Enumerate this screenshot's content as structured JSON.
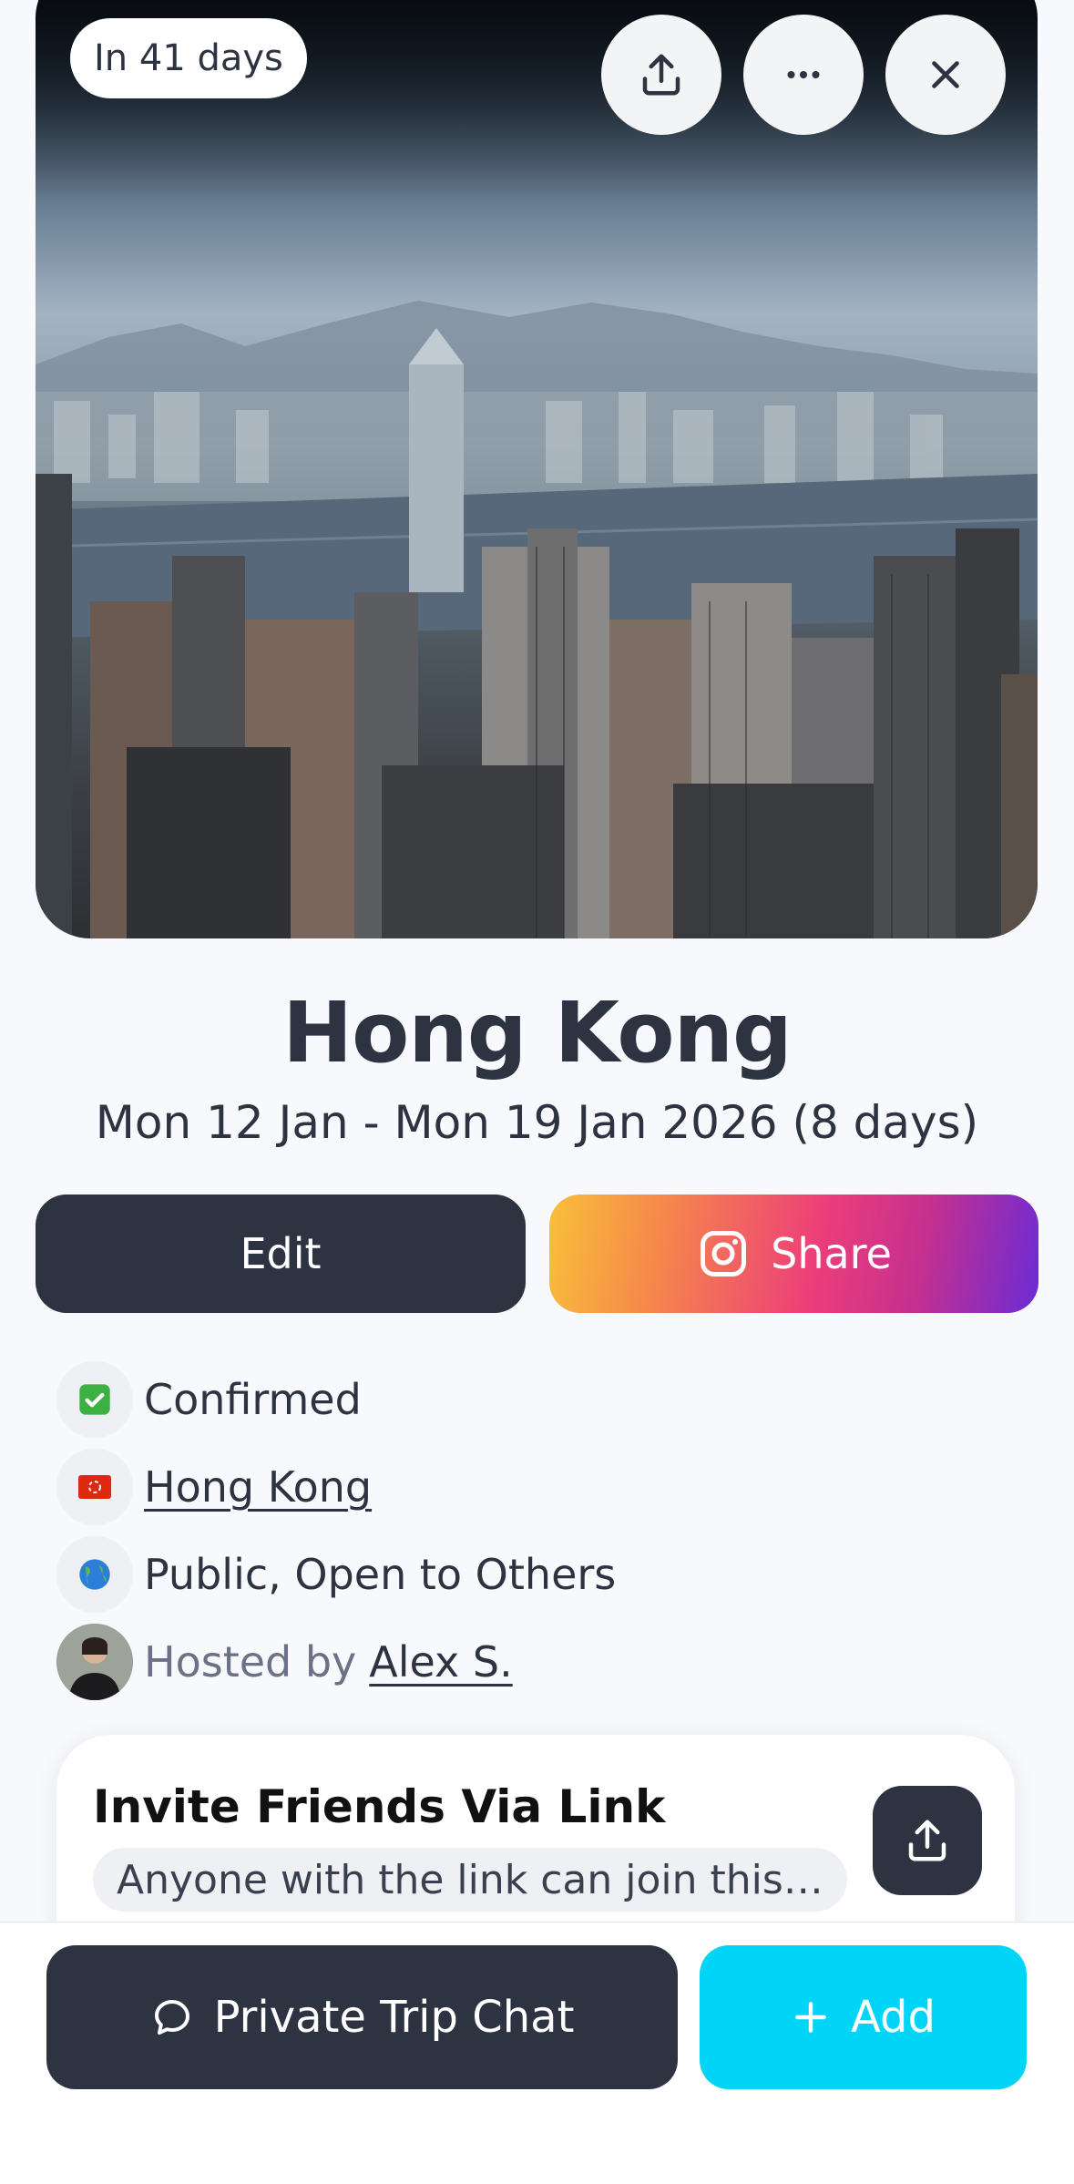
{
  "hero": {
    "countdown_label": "In 41 days"
  },
  "header_actions": {
    "share_icon": "upload-icon",
    "more_icon": "more-horizontal-icon",
    "close_icon": "close-icon"
  },
  "trip": {
    "title": "Hong Kong",
    "dates": "Mon 12 Jan - Mon 19 Jan 2026 (8 days)"
  },
  "actions": {
    "edit_label": "Edit",
    "share_label": "Share",
    "share_icon": "instagram-icon"
  },
  "details": {
    "status_label": "Confirmed",
    "status_icon": "check-mark-icon",
    "destination_label": "Hong Kong",
    "destination_icon": "hong-kong-flag-icon",
    "visibility_label": "Public, Open to Others",
    "visibility_icon": "globe-icon",
    "hosted_by_prefix": "Hosted by",
    "host_name": "Alex S."
  },
  "invite": {
    "title": "Invite Friends Via Link",
    "subtitle": "Anyone with the link can join this…",
    "share_icon": "upload-icon"
  },
  "bottom_bar": {
    "chat_label": "Private Trip Chat",
    "chat_icon": "chat-bubble-icon",
    "add_label": "Add",
    "add_icon": "plus-icon"
  },
  "colors": {
    "primary_dark": "#2e3342",
    "accent_cyan": "#00d4f7",
    "background": "#f7f9fc"
  }
}
